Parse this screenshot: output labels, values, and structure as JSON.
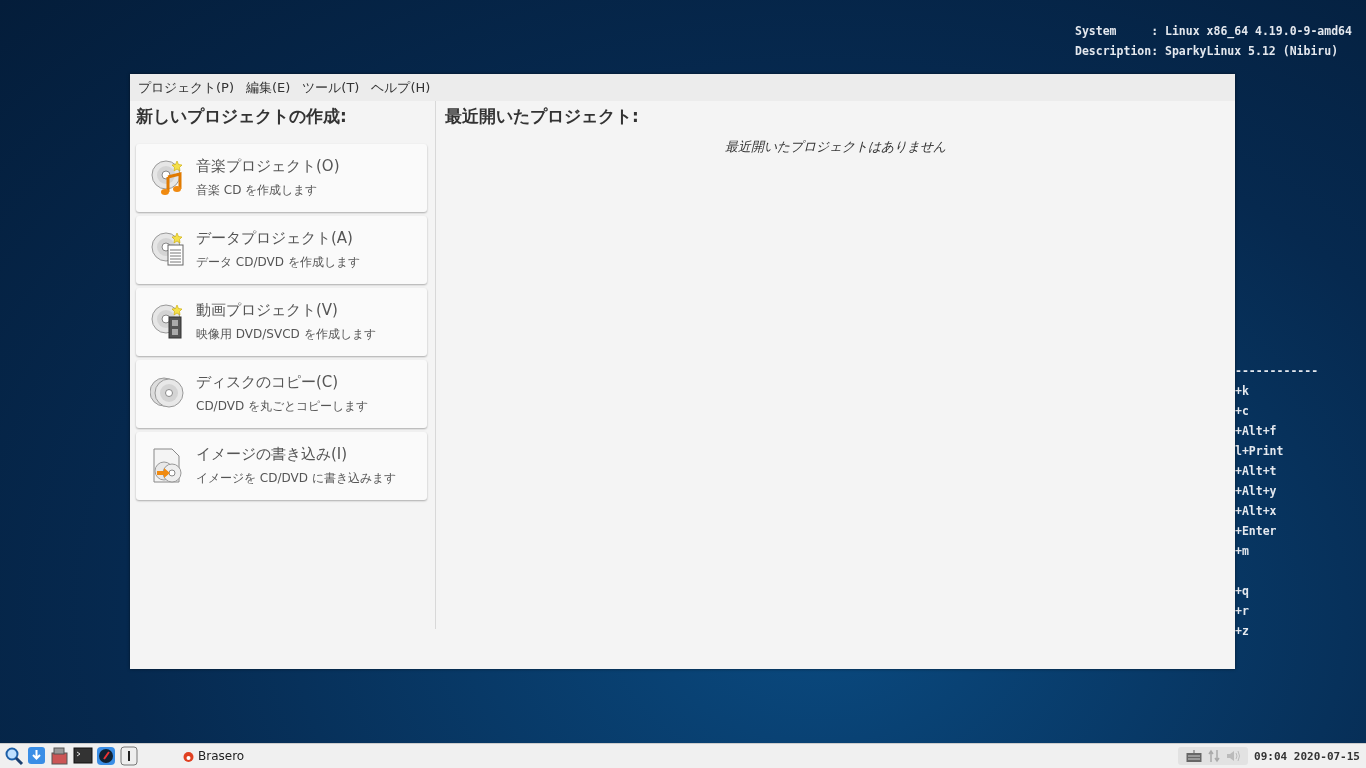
{
  "desktop_info": [
    "System     : Linux x86_64 4.19.0-9-amd64",
    "Description: SparkyLinux 5.12 (Nibiru)"
  ],
  "shortcut_groups": [
    [
      "------------",
      "+k",
      "+c",
      "+Alt+f",
      "l+Print",
      "+Alt+t",
      "+Alt+y",
      "+Alt+x",
      "+Enter",
      "+m"
    ],
    [
      "+q",
      "+r",
      "+z"
    ]
  ],
  "window": {
    "menu": [
      "プロジェクト(P)",
      "編集(E)",
      "ツール(T)",
      "ヘルプ(H)"
    ],
    "new_project": {
      "heading": "新しいプロジェクトの作成:",
      "items": [
        {
          "kind": "audio",
          "title": "音楽プロジェクト(O)",
          "subtitle": "音楽 CD を作成します"
        },
        {
          "kind": "data",
          "title": "データプロジェクト(A)",
          "subtitle": "データ CD/DVD を作成します"
        },
        {
          "kind": "video",
          "title": "動画プロジェクト(V)",
          "subtitle": "映像用 DVD/SVCD を作成します"
        },
        {
          "kind": "copy",
          "title": "ディスクのコピー(C)",
          "subtitle": "CD/DVD を丸ごとコピーします"
        },
        {
          "kind": "image",
          "title": "イメージの書き込み(I)",
          "subtitle": "イメージを CD/DVD に書き込みます"
        }
      ]
    },
    "recent": {
      "heading": "最近開いたプロジェクト:",
      "empty_message": "最近開いたプロジェクトはありません"
    }
  },
  "taskbar": {
    "launchers": [
      {
        "kind": "search"
      },
      {
        "kind": "download"
      },
      {
        "kind": "package"
      },
      {
        "kind": "terminal"
      },
      {
        "kind": "browser"
      },
      {
        "kind": "text"
      }
    ],
    "task": {
      "label": "Brasero"
    },
    "clock": "09:04 2020-07-15"
  }
}
